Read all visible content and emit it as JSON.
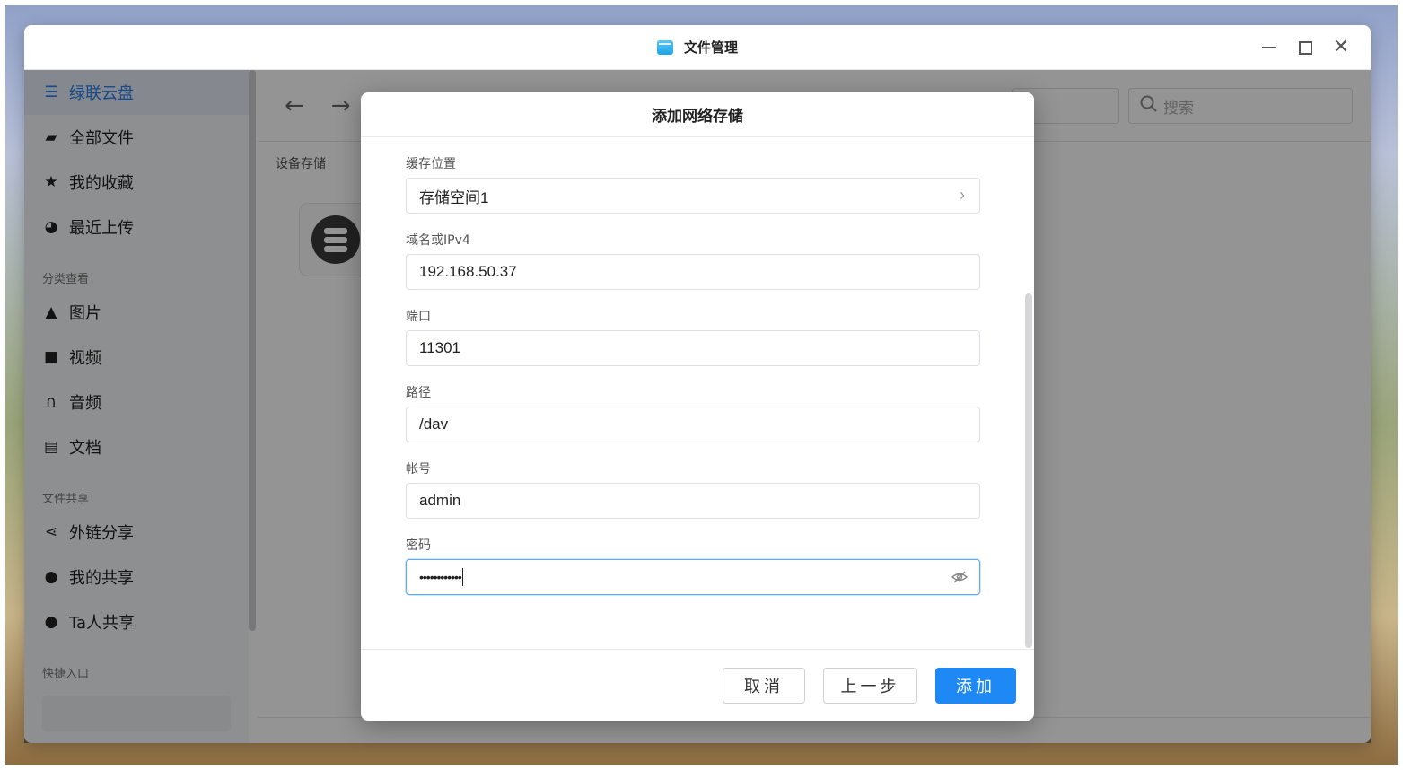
{
  "window": {
    "title": "文件管理"
  },
  "sidebar": {
    "items": [
      {
        "label": "绿联云盘",
        "icon": "storage-icon",
        "active": true
      },
      {
        "label": "全部文件",
        "icon": "folder-icon"
      },
      {
        "label": "我的收藏",
        "icon": "star-icon"
      },
      {
        "label": "最近上传",
        "icon": "clock-icon"
      }
    ],
    "section_category": "分类查看",
    "category_items": [
      {
        "label": "图片",
        "icon": "image-icon"
      },
      {
        "label": "视频",
        "icon": "video-icon"
      },
      {
        "label": "音频",
        "icon": "headphones-icon"
      },
      {
        "label": "文档",
        "icon": "document-icon"
      }
    ],
    "section_share": "文件共享",
    "share_items": [
      {
        "label": "外链分享",
        "icon": "share-icon"
      },
      {
        "label": "我的共享",
        "icon": "user-share-icon"
      },
      {
        "label": "Ta人共享",
        "icon": "users-icon"
      }
    ],
    "section_quick": "快捷入口"
  },
  "main": {
    "search_placeholder": "搜索",
    "section_label": "设备存储"
  },
  "dialog": {
    "title": "添加网络存储",
    "fields": {
      "cache_location": {
        "label": "缓存位置",
        "value": "存储空间1"
      },
      "host": {
        "label": "域名或IPv4",
        "value": "192.168.50.37"
      },
      "port": {
        "label": "端口",
        "value": "11301"
      },
      "path": {
        "label": "路径",
        "value": "/dav"
      },
      "account": {
        "label": "帐号",
        "value": "admin"
      },
      "password": {
        "label": "密码",
        "value": "••••••••••••"
      }
    },
    "buttons": {
      "cancel": "取消",
      "previous": "上一步",
      "add": "添加"
    }
  },
  "colors": {
    "accent": "#1e88f5",
    "active_text": "#2680eb"
  }
}
